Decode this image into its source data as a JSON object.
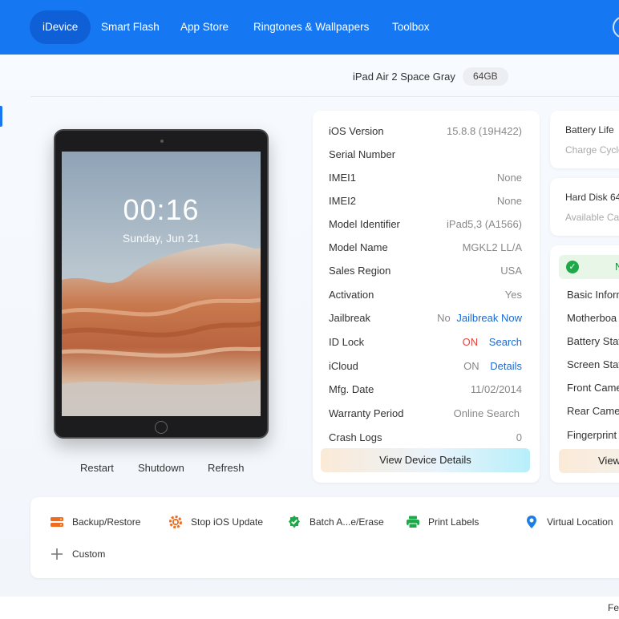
{
  "nav": {
    "items": [
      {
        "label": "iDevice",
        "active": true
      },
      {
        "label": "Smart Flash"
      },
      {
        "label": "App Store"
      },
      {
        "label": "Ringtones & Wallpapers"
      },
      {
        "label": "Toolbox"
      }
    ],
    "accent_color": "#1677f2"
  },
  "device": {
    "name": "iPad Air 2 Space Gray",
    "capacity": "64GB",
    "lock_time": "00:16",
    "lock_date": "Sunday, Jun 21",
    "actions": [
      "Restart",
      "Shutdown",
      "Refresh"
    ]
  },
  "info": {
    "rows": [
      {
        "label": "iOS Version",
        "value": "15.8.8 (19H422)"
      },
      {
        "label": "Serial Number",
        "value": ""
      },
      {
        "label": "IMEI1",
        "value": "None"
      },
      {
        "label": "IMEI2",
        "value": "None"
      },
      {
        "label": "Model Identifier",
        "value": "iPad5,3 (A1566)"
      },
      {
        "label": "Model Name",
        "value": "MGKL2 LL/A"
      },
      {
        "label": "Sales Region",
        "value": "USA"
      },
      {
        "label": "Activation",
        "value": "Yes"
      },
      {
        "label": "Jailbreak",
        "value": "No",
        "link": "Jailbreak Now"
      },
      {
        "label": "ID Lock",
        "value": "ON",
        "link": "Search"
      },
      {
        "label": "iCloud",
        "value": "ON",
        "link": "Details"
      },
      {
        "label": "Mfg. Date",
        "value": "11/02/2014"
      },
      {
        "label": "Warranty Period",
        "value": "",
        "link": "Online Search"
      },
      {
        "label": "Crash Logs",
        "value": "0"
      }
    ],
    "view_details_label": "View Device Details"
  },
  "right": {
    "battery": {
      "title": "Battery Life",
      "sub": "Charge Cycle"
    },
    "disk": {
      "title": "Hard Disk 64",
      "sub": "Available Cap"
    },
    "check": {
      "head": "N",
      "items": [
        "Basic Inform",
        "Motherboa",
        "Battery Stat",
        "Screen Stat",
        "Front Came",
        "Rear Came",
        "Fingerprint"
      ],
      "view_label": "View"
    }
  },
  "tools": {
    "items": [
      {
        "label": "Backup/Restore",
        "icon": "backup-icon",
        "color": "#f26b1d"
      },
      {
        "label": "Stop iOS Update",
        "icon": "gear-stop-icon",
        "color": "#f26b1d"
      },
      {
        "label": "Batch A...e/Erase",
        "icon": "batch-check-icon",
        "color": "#1ea84a"
      },
      {
        "label": "Print Labels",
        "icon": "printer-icon",
        "color": "#1ea84a"
      },
      {
        "label": "Virtual Location",
        "icon": "location-pin-icon",
        "color": "#1a7ee6"
      },
      {
        "label": "Custom",
        "icon": "plus-icon",
        "color": "#777777"
      }
    ]
  },
  "footer": {
    "text": "Fe"
  }
}
